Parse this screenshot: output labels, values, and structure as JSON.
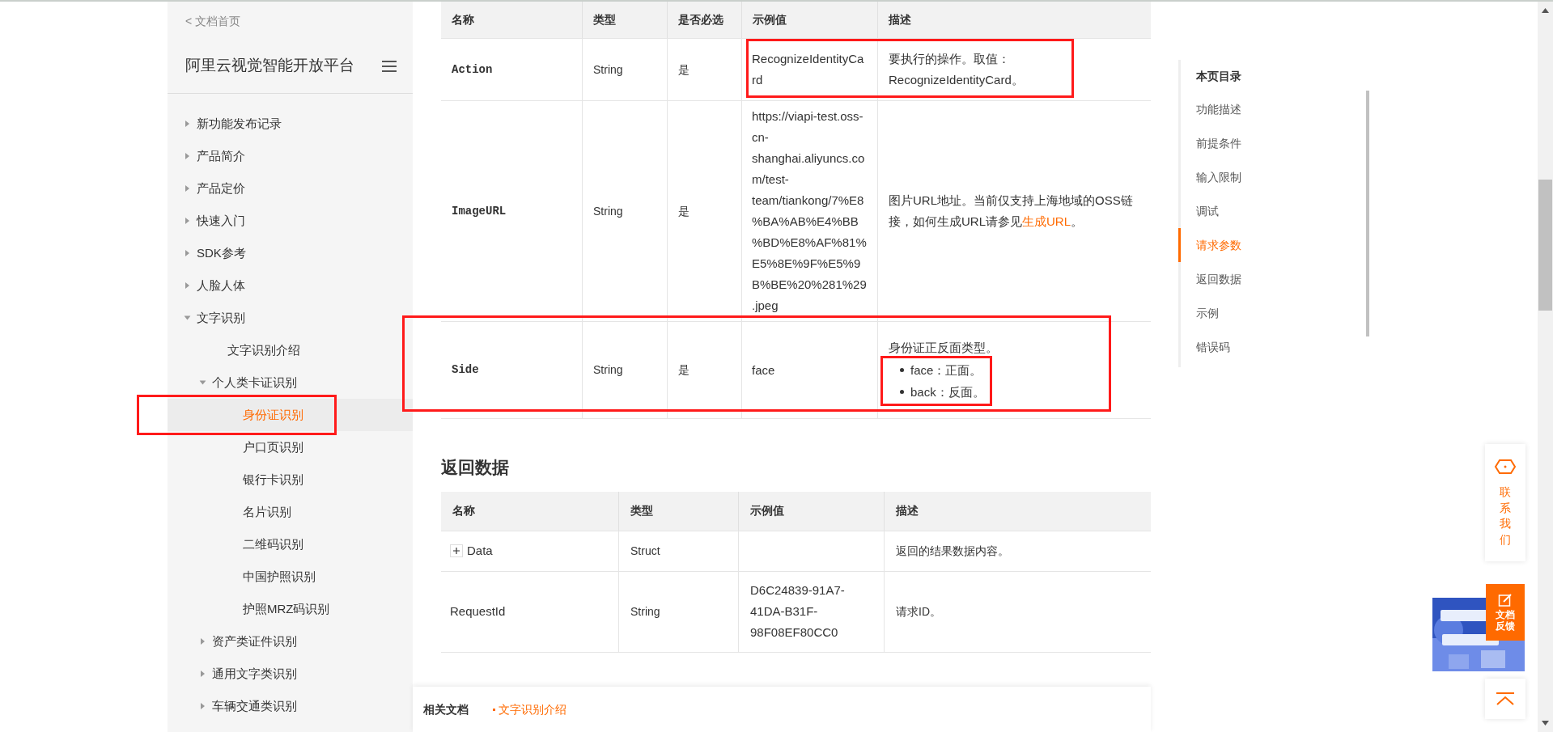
{
  "sidebar": {
    "back_link": "< 文档首页",
    "title": "阿里云视觉智能开放平台",
    "items": [
      {
        "label": "新功能发布记录",
        "expanded": false,
        "selected": false,
        "highlighted": false
      },
      {
        "label": "产品简介",
        "expanded": false,
        "selected": false,
        "highlighted": false
      },
      {
        "label": "产品定价",
        "expanded": false,
        "selected": false,
        "highlighted": false
      },
      {
        "label": "快速入门",
        "expanded": false,
        "selected": false,
        "highlighted": false
      },
      {
        "label": "SDK参考",
        "expanded": false,
        "selected": false,
        "highlighted": false
      },
      {
        "label": "人脸人体",
        "expanded": false,
        "selected": false,
        "highlighted": false
      },
      {
        "label": "文字识别",
        "expanded": true,
        "selected": false,
        "highlighted": false,
        "children": [
          {
            "label": "文字识别介绍",
            "selected": false,
            "highlighted": false
          },
          {
            "label": "个人类卡证识别",
            "expanded": true,
            "selected": false,
            "highlighted": false,
            "children": [
              {
                "label": "身份证识别",
                "selected": true,
                "highlighted": true
              },
              {
                "label": "户口页识别",
                "selected": false,
                "highlighted": false
              },
              {
                "label": "银行卡识别",
                "selected": false,
                "highlighted": false
              },
              {
                "label": "名片识别",
                "selected": false,
                "highlighted": false
              },
              {
                "label": "二维码识别",
                "selected": false,
                "highlighted": false
              },
              {
                "label": "中国护照识别",
                "selected": false,
                "highlighted": false
              },
              {
                "label": "护照MRZ码识别",
                "selected": false,
                "highlighted": false
              }
            ]
          },
          {
            "label": "资产类证件识别",
            "expanded": false,
            "selected": false,
            "highlighted": false
          },
          {
            "label": "通用文字类识别",
            "expanded": false,
            "selected": false,
            "highlighted": false
          },
          {
            "label": "车辆交通类识别",
            "expanded": false,
            "selected": false,
            "highlighted": false
          }
        ]
      }
    ]
  },
  "request_params": {
    "columns": [
      "名称",
      "类型",
      "是否必选",
      "示例值",
      "描述"
    ],
    "rows": [
      {
        "name": "Action",
        "type": "String",
        "required": "是",
        "example": "RecognizeIdentityCard",
        "values_highlighted": true,
        "row_highlighted": false,
        "description": {
          "segments": [
            {
              "kind": "text",
              "text": "要执行的操作。取值："
            },
            {
              "kind": "text",
              "text": "RecognizeIdentityCard。"
            }
          ]
        }
      },
      {
        "name": "ImageURL",
        "type": "String",
        "required": "是",
        "example": "https://viapi-test.oss-cn-shanghai.aliyuncs.com/test-team/tiankong/7%E8%BA%AB%E4%BB%BD%E8%AF%81%E5%8E%9F%E5%9B%BE%20%281%29.jpeg",
        "values_highlighted": false,
        "row_highlighted": false,
        "description": {
          "segments": [
            {
              "kind": "text",
              "text": "图片URL地址。当前仅支持上海地域的OSS链接，如何生成URL请参见"
            },
            {
              "kind": "link",
              "text": "生成URL"
            },
            {
              "kind": "text",
              "text": "。"
            }
          ]
        }
      },
      {
        "name": "Side",
        "type": "String",
        "required": "是",
        "example": "face",
        "values_highlighted": false,
        "row_highlighted": true,
        "description": {
          "segments": [
            {
              "kind": "text",
              "text": "身份证正反面类型。"
            }
          ],
          "bullets": [
            "face：正面。",
            "back：反面。"
          ],
          "bullets_highlighted": true
        }
      }
    ]
  },
  "return_data": {
    "heading": "返回数据",
    "columns": [
      "名称",
      "类型",
      "示例值",
      "描述"
    ],
    "rows": [
      {
        "name": "Data",
        "expandable": true,
        "expanded": false,
        "type": "Struct",
        "example": "",
        "description": "返回的结果数据内容。"
      },
      {
        "name": "RequestId",
        "expandable": false,
        "type": "String",
        "example": "D6C24839-91A7-41DA-B31F-98F08EF80CC0",
        "description": "请求ID。"
      }
    ]
  },
  "related_docs": {
    "label": "相关文档",
    "links": [
      "文字识别介绍"
    ]
  },
  "toc": {
    "title": "本页目录",
    "items": [
      {
        "label": "功能描述",
        "selected": false
      },
      {
        "label": "前提条件",
        "selected": false
      },
      {
        "label": "输入限制",
        "selected": false
      },
      {
        "label": "调试",
        "selected": false
      },
      {
        "label": "请求参数",
        "selected": true
      },
      {
        "label": "返回数据",
        "selected": false
      },
      {
        "label": "示例",
        "selected": false
      },
      {
        "label": "错误码",
        "selected": false
      }
    ]
  },
  "floating": {
    "contact": "联系我们",
    "feedback": "文档反馈"
  }
}
